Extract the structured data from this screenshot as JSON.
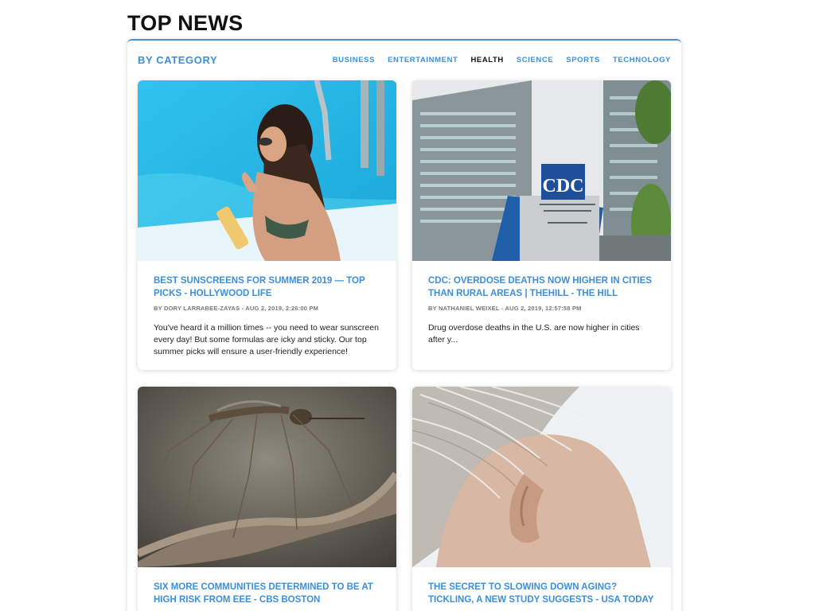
{
  "page": {
    "title": "TOP NEWS"
  },
  "panel": {
    "heading": "BY CATEGORY",
    "categories": [
      {
        "label": "BUSINESS",
        "active": false
      },
      {
        "label": "ENTERTAINMENT",
        "active": false
      },
      {
        "label": "HEALTH",
        "active": true
      },
      {
        "label": "SCIENCE",
        "active": false
      },
      {
        "label": "SPORTS",
        "active": false
      },
      {
        "label": "TECHNOLOGY",
        "active": false
      }
    ]
  },
  "articles": [
    {
      "title": "BEST SUNSCREENS FOR SUMMER 2019 — TOP PICKS - HOLLYWOOD LIFE",
      "author": "BY DORY LARRABEE-ZAYAS",
      "date": "- AUG 2, 2019, 2:26:00 PM",
      "description": "You've heard it a million times -- you need to wear sunscreen every day! But some formulas are icky and sticky. Our top summer picks will ensure a user-friendly experience!",
      "image": "woman-applying-sunscreen-by-pool"
    },
    {
      "title": "CDC: OVERDOSE DEATHS NOW HIGHER IN CITIES THAN RURAL AREAS | THEHILL - THE HILL",
      "author": "BY NATHANIEL WEIXEL",
      "date": "- AUG 2, 2019, 12:57:58 PM",
      "description": "Drug overdose deaths in the U.S. are now higher in cities after y...",
      "image": "cdc-headquarters-building"
    },
    {
      "title": "SIX MORE COMMUNITIES DETERMINED TO BE AT HIGH RISK FROM EEE - CBS BOSTON",
      "author": "",
      "date": "",
      "description": "",
      "image": "mosquito-on-twig"
    },
    {
      "title": "THE SECRET TO SLOWING DOWN AGING? TICKLING, A NEW STUDY SUGGESTS - USA TODAY",
      "author": "",
      "date": "",
      "description": "",
      "image": "elderly-ear-closeup"
    }
  ],
  "colors": {
    "accent": "#3d8fd8",
    "active_tab": "#111111"
  }
}
